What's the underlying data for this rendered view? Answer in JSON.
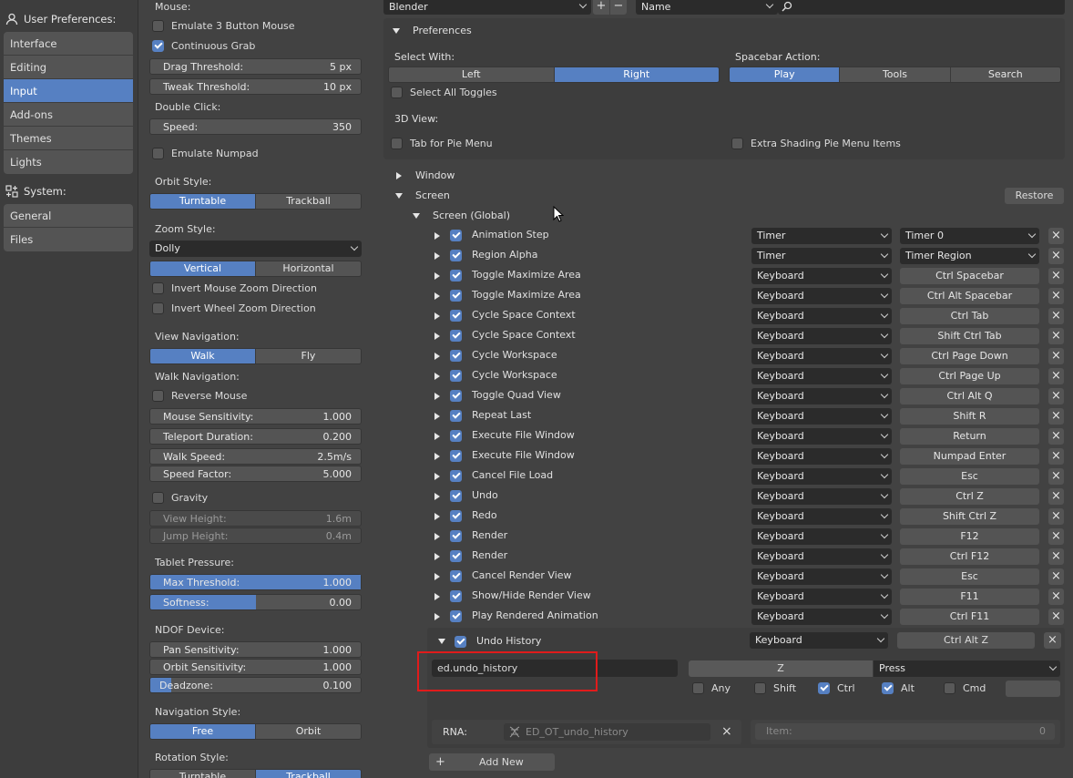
{
  "sidebar": {
    "user_prefs_label": "User Preferences:",
    "system_label": "System:",
    "user_items": [
      {
        "label": "Interface",
        "active": false
      },
      {
        "label": "Editing",
        "active": false
      },
      {
        "label": "Input",
        "active": true
      },
      {
        "label": "Add-ons",
        "active": false
      },
      {
        "label": "Themes",
        "active": false
      },
      {
        "label": "Lights",
        "active": false
      }
    ],
    "system_items": [
      {
        "label": "General"
      },
      {
        "label": "Files"
      }
    ]
  },
  "mid": {
    "mouse_label": "Mouse:",
    "emulate_3_button": {
      "label": "Emulate 3 Button Mouse",
      "checked": false
    },
    "continuous_grab": {
      "label": "Continuous Grab",
      "checked": true
    },
    "drag_threshold": {
      "label": "Drag Threshold:",
      "value": "5 px"
    },
    "tweak_threshold": {
      "label": "Tweak Threshold:",
      "value": "10 px"
    },
    "double_click_label": "Double Click:",
    "speed": {
      "label": "Speed:",
      "value": "350"
    },
    "emulate_numpad": {
      "label": "Emulate Numpad",
      "checked": false
    },
    "orbit_style_label": "Orbit Style:",
    "orbit_style": [
      "Turntable",
      "Trackball"
    ],
    "zoom_style_label": "Zoom Style:",
    "zoom_style_value": "Dolly",
    "zoom_axis": [
      "Vertical",
      "Horizontal"
    ],
    "invert_mouse_zoom": {
      "label": "Invert Mouse Zoom Direction",
      "checked": false
    },
    "invert_wheel_zoom": {
      "label": "Invert Wheel Zoom Direction",
      "checked": false
    },
    "view_nav_label": "View Navigation:",
    "view_nav": [
      "Walk",
      "Fly"
    ],
    "walk_nav_label": "Walk Navigation:",
    "reverse_mouse": {
      "label": "Reverse Mouse",
      "checked": false
    },
    "mouse_sensitivity": {
      "label": "Mouse Sensitivity:",
      "value": "1.000"
    },
    "teleport_duration": {
      "label": "Teleport Duration:",
      "value": "0.200"
    },
    "walk_speed": {
      "label": "Walk Speed:",
      "value": "2.5m/s"
    },
    "speed_factor": {
      "label": "Speed Factor:",
      "value": "5.000"
    },
    "gravity": {
      "label": "Gravity",
      "checked": false
    },
    "view_height": {
      "label": "View Height:",
      "value": "1.6m"
    },
    "jump_height": {
      "label": "Jump Height:",
      "value": "0.4m"
    },
    "tablet_label": "Tablet Pressure:",
    "max_threshold": {
      "label": "Max Threshold:",
      "value": "1.000",
      "fill": 1.0
    },
    "softness": {
      "label": "Softness:",
      "value": "0.00",
      "fill": 0.5
    },
    "ndof_label": "NDOF Device:",
    "pan_sensitivity": {
      "label": "Pan Sensitivity:",
      "value": "1.000"
    },
    "orbit_sensitivity": {
      "label": "Orbit Sensitivity:",
      "value": "1.000"
    },
    "deadzone": {
      "label": "Deadzone:",
      "value": "0.100",
      "fill": 0.1
    },
    "nav_style_label": "Navigation Style:",
    "nav_style": [
      "Free",
      "Orbit"
    ],
    "rotation_style_label": "Rotation Style:",
    "rotation_style": [
      "Turntable",
      "Trackball"
    ]
  },
  "right": {
    "preset_value": "Blender",
    "search_mode": "Name",
    "prefs_title": "Preferences",
    "select_with_label": "Select With:",
    "select_with": [
      "Left",
      "Right"
    ],
    "spacebar_label": "Spacebar Action:",
    "spacebar": [
      "Play",
      "Tools",
      "Search"
    ],
    "select_all_toggles": "Select All Toggles",
    "view3d_label": "3D View:",
    "tab_pie_menu": "Tab for Pie Menu",
    "extra_shading": "Extra Shading Pie Menu Items",
    "window_label": "Window",
    "screen_label": "Screen",
    "restore_label": "Restore",
    "screen_global_label": "Screen (Global)",
    "keymap_rows": [
      {
        "name": "Animation Step",
        "type": "Timer",
        "key": "Timer 0",
        "key_dd": true
      },
      {
        "name": "Region Alpha",
        "type": "Timer",
        "key": "Timer Region",
        "key_dd": true
      },
      {
        "name": "Toggle Maximize Area",
        "type": "Keyboard",
        "key": "Ctrl Spacebar"
      },
      {
        "name": "Toggle Maximize Area",
        "type": "Keyboard",
        "key": "Ctrl Alt Spacebar"
      },
      {
        "name": "Cycle Space Context",
        "type": "Keyboard",
        "key": "Ctrl Tab"
      },
      {
        "name": "Cycle Space Context",
        "type": "Keyboard",
        "key": "Shift Ctrl Tab"
      },
      {
        "name": "Cycle Workspace",
        "type": "Keyboard",
        "key": "Ctrl Page Down"
      },
      {
        "name": "Cycle Workspace",
        "type": "Keyboard",
        "key": "Ctrl Page Up"
      },
      {
        "name": "Toggle Quad View",
        "type": "Keyboard",
        "key": "Ctrl Alt Q"
      },
      {
        "name": "Repeat Last",
        "type": "Keyboard",
        "key": "Shift R"
      },
      {
        "name": "Execute File Window",
        "type": "Keyboard",
        "key": "Return"
      },
      {
        "name": "Execute File Window",
        "type": "Keyboard",
        "key": "Numpad Enter"
      },
      {
        "name": "Cancel File Load",
        "type": "Keyboard",
        "key": "Esc"
      },
      {
        "name": "Undo",
        "type": "Keyboard",
        "key": "Ctrl Z"
      },
      {
        "name": "Redo",
        "type": "Keyboard",
        "key": "Shift Ctrl Z"
      },
      {
        "name": "Render",
        "type": "Keyboard",
        "key": "F12"
      },
      {
        "name": "Render",
        "type": "Keyboard",
        "key": "Ctrl F12"
      },
      {
        "name": "Cancel Render View",
        "type": "Keyboard",
        "key": "Esc"
      },
      {
        "name": "Show/Hide Render View",
        "type": "Keyboard",
        "key": "F11"
      },
      {
        "name": "Play Rendered Animation",
        "type": "Keyboard",
        "key": "Ctrl F11"
      }
    ],
    "expanded": {
      "name": "Undo History",
      "type": "Keyboard",
      "key": "Ctrl Alt Z",
      "idname": "ed.undo_history",
      "key_value": "Z",
      "event_value": "Press",
      "modifiers": [
        {
          "label": "Any",
          "checked": false
        },
        {
          "label": "Shift",
          "checked": false
        },
        {
          "label": "Ctrl",
          "checked": true
        },
        {
          "label": "Alt",
          "checked": true
        },
        {
          "label": "Cmd",
          "checked": false
        }
      ],
      "rna_label": "RNA:",
      "rna_value": "ED_OT_undo_history",
      "item_label": "Item:",
      "item_value": "0"
    },
    "add_new_label": "Add New",
    "highlight_color": "#e01b1b"
  }
}
